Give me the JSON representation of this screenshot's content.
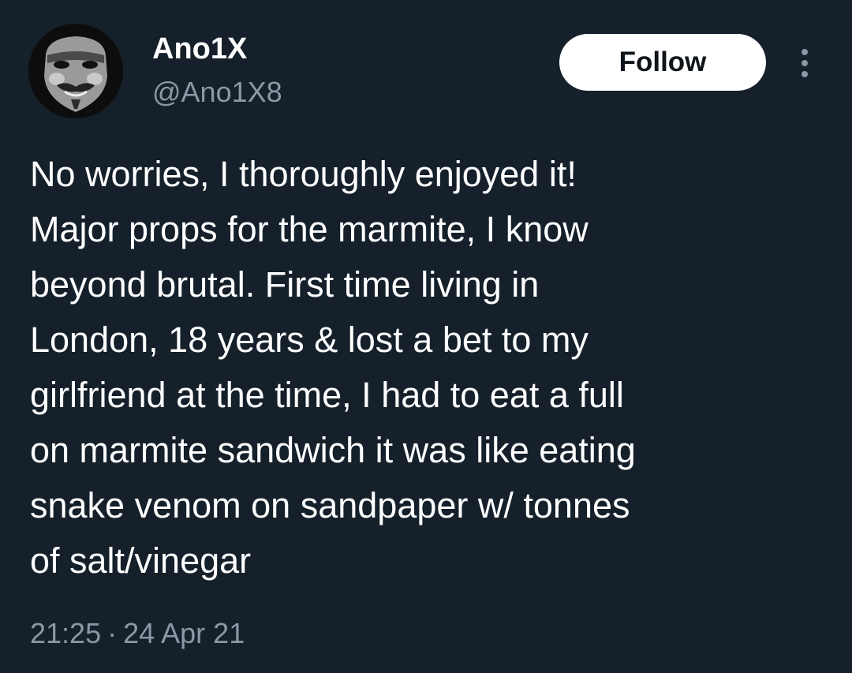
{
  "author": {
    "display_name": "Ano1X",
    "handle": "@Ano1X8"
  },
  "actions": {
    "follow_label": "Follow",
    "more_icon": "more-vertical-icon"
  },
  "tweet": {
    "lines": [
      "No worries, I thoroughly enjoyed it!",
      "Major props for the marmite, I know",
      "beyond brutal. First time living in",
      "London, 18 years & lost a bet to my",
      "girlfriend at the time, I had to eat a full",
      "on marmite sandwich it was like eating",
      "snake venom on sandpaper w/ tonnes",
      "of salt/vinegar"
    ],
    "time": "21:25",
    "separator": "·",
    "date": "24 Apr 21"
  },
  "colors": {
    "background": "#15202b",
    "text": "#ffffff",
    "muted": "#8b98a5",
    "button_bg": "#ffffff",
    "button_text": "#0f1419"
  }
}
